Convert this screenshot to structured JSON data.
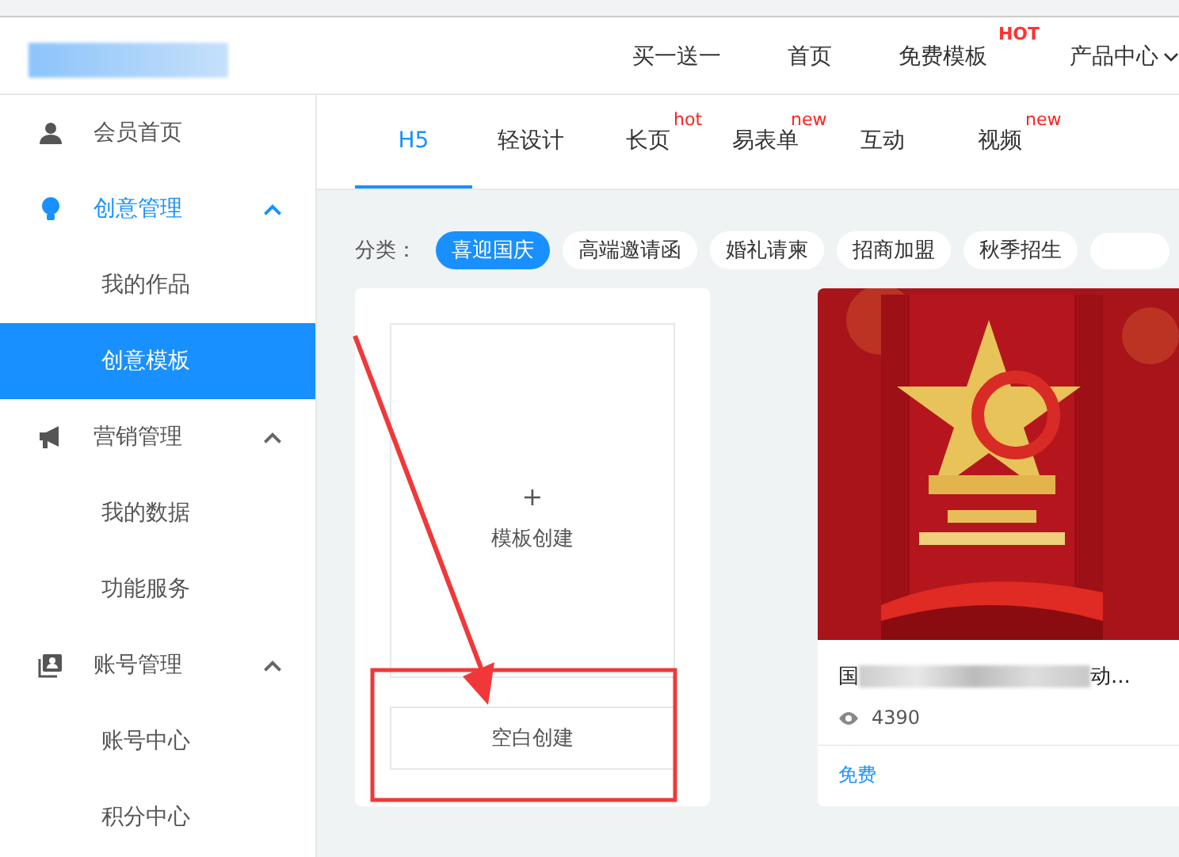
{
  "header": {
    "nav": [
      {
        "label": "买一送一"
      },
      {
        "label": "首页"
      },
      {
        "label": "免费模板",
        "badge": "HOT"
      },
      {
        "label": "产品中心",
        "dropdown": true
      }
    ]
  },
  "sidebar": {
    "items": [
      {
        "label": "会员首页",
        "selected": false
      },
      {
        "label": "创意管理",
        "selected": false,
        "active": true,
        "expanded": true,
        "children": [
          {
            "label": "我的作品",
            "selected": false
          },
          {
            "label": "创意模板",
            "selected": true
          }
        ]
      },
      {
        "label": "营销管理",
        "selected": false,
        "active": false,
        "expanded": true,
        "children": [
          {
            "label": "我的数据",
            "selected": false
          },
          {
            "label": "功能服务",
            "selected": false
          }
        ]
      },
      {
        "label": "账号管理",
        "selected": false,
        "active": false,
        "expanded": true,
        "children": [
          {
            "label": "账号中心",
            "selected": false
          },
          {
            "label": "积分中心",
            "selected": false
          }
        ]
      }
    ]
  },
  "tabs": [
    {
      "label": "H5",
      "selected": true
    },
    {
      "label": "轻设计",
      "selected": false
    },
    {
      "label": "长页",
      "selected": false,
      "badge": "hot"
    },
    {
      "label": "易表单",
      "selected": false,
      "badge": "new"
    },
    {
      "label": "互动",
      "selected": false
    },
    {
      "label": "视频",
      "selected": false,
      "badge": "new"
    }
  ],
  "categories": {
    "label": "分类：",
    "items": [
      {
        "label": "喜迎国庆",
        "selected": true
      },
      {
        "label": "高端邀请函",
        "selected": false
      },
      {
        "label": "婚礼请柬",
        "selected": false
      },
      {
        "label": "招商加盟",
        "selected": false
      },
      {
        "label": "秋季招生",
        "selected": false
      }
    ]
  },
  "create_card": {
    "plus": "+",
    "template_label": "模板创建",
    "blank_button": "空白创建"
  },
  "template_card": {
    "title_start": "国",
    "title_end": "动...",
    "views": "4390",
    "price": "免费"
  }
}
